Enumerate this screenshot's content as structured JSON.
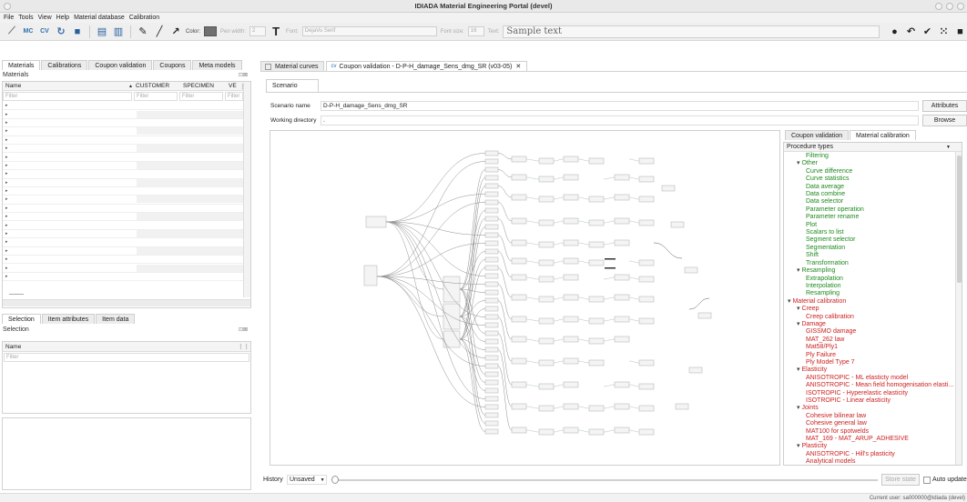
{
  "window": {
    "title": "IDIADA Material Engineering Portal (devel)"
  },
  "menu": [
    "File",
    "Tools",
    "View",
    "Help",
    "Material database",
    "Calibration"
  ],
  "toolbar": {
    "color_label": "Color:",
    "pen_width_label": "Pen width:",
    "pen_width_value": "2",
    "font_label": "Font:",
    "font_value": "DejaVu Serif",
    "font_size_label": "Font size:",
    "font_size_value": "16",
    "text_label": "Text:",
    "sample_text": "Sample text",
    "color_swatch": "#707070"
  },
  "left_tabs": [
    "Materials",
    "Calibrations",
    "Coupon validation",
    "Coupons",
    "Meta models"
  ],
  "materials": {
    "title": "Materials",
    "columns": [
      "Name",
      "CUSTOMER",
      "SPECIMEN",
      "VE"
    ],
    "filter_placeholder": "Filter",
    "last_row": "--------"
  },
  "selection_tabs": [
    "Selection",
    "Item attributes",
    "Item data"
  ],
  "selection": {
    "title": "Selection",
    "column": "Name",
    "filter_placeholder": "Filter"
  },
  "doc_tabs": [
    {
      "label": "Material curves",
      "active": false
    },
    {
      "label": "Coupon validation - D-P-H_damage_Sens_dmg_SR (v03-05)",
      "active": true
    }
  ],
  "scenario": {
    "tab": "Scenario",
    "name_label": "Scenario name",
    "name_value": "D-P-H_damage_Sens_dmg_SR",
    "workdir_label": "Working directory",
    "workdir_value": ".",
    "attributes_btn": "Attributes",
    "browse_btn": "Browse"
  },
  "right_tabs": [
    "Coupon validation",
    "Material calibration"
  ],
  "procedure": {
    "title": "Procedure types",
    "items": [
      {
        "text": "Filtering",
        "level": 2,
        "cls": "g"
      },
      {
        "text": "Other",
        "level": 1,
        "cls": "g",
        "group": true
      },
      {
        "text": "Curve difference",
        "level": 2,
        "cls": "g"
      },
      {
        "text": "Curve statistics",
        "level": 2,
        "cls": "g"
      },
      {
        "text": "Data average",
        "level": 2,
        "cls": "g"
      },
      {
        "text": "Data combine",
        "level": 2,
        "cls": "g"
      },
      {
        "text": "Data selector",
        "level": 2,
        "cls": "g"
      },
      {
        "text": "Parameter operation",
        "level": 2,
        "cls": "g"
      },
      {
        "text": "Parameter rename",
        "level": 2,
        "cls": "g"
      },
      {
        "text": "Plot",
        "level": 2,
        "cls": "g"
      },
      {
        "text": "Scalars to list",
        "level": 2,
        "cls": "g"
      },
      {
        "text": "Segment selector",
        "level": 2,
        "cls": "g"
      },
      {
        "text": "Segmentation",
        "level": 2,
        "cls": "g"
      },
      {
        "text": "Shift",
        "level": 2,
        "cls": "g"
      },
      {
        "text": "Transformation",
        "level": 2,
        "cls": "g"
      },
      {
        "text": "Resampling",
        "level": 1,
        "cls": "g",
        "group": true
      },
      {
        "text": "Extrapolation",
        "level": 2,
        "cls": "g"
      },
      {
        "text": "Interpolation",
        "level": 2,
        "cls": "g"
      },
      {
        "text": "Resampling",
        "level": 2,
        "cls": "g"
      },
      {
        "text": "Material calibration",
        "level": 0,
        "cls": "r",
        "group": true
      },
      {
        "text": "Creep",
        "level": 1,
        "cls": "r",
        "group": true
      },
      {
        "text": "Creep calibration",
        "level": 2,
        "cls": "r"
      },
      {
        "text": "Damage",
        "level": 1,
        "cls": "r",
        "group": true
      },
      {
        "text": "GISSMO damage",
        "level": 2,
        "cls": "r"
      },
      {
        "text": "MAT_262 law",
        "level": 2,
        "cls": "r"
      },
      {
        "text": "Mat58/Ply1",
        "level": 2,
        "cls": "r"
      },
      {
        "text": "Ply Failure",
        "level": 2,
        "cls": "r"
      },
      {
        "text": "Ply Model Type 7",
        "level": 2,
        "cls": "r"
      },
      {
        "text": "Elasticity",
        "level": 1,
        "cls": "r",
        "group": true
      },
      {
        "text": "ANISOTROPIC - ML elasticty model",
        "level": 2,
        "cls": "r"
      },
      {
        "text": "ANISOTROPIC - Mean field homogenisation elasti...",
        "level": 2,
        "cls": "r"
      },
      {
        "text": "ISOTROPIC - Hyperelastic elasticity",
        "level": 2,
        "cls": "r"
      },
      {
        "text": "ISOTROPIC - Linear elasticity",
        "level": 2,
        "cls": "r"
      },
      {
        "text": "Joints",
        "level": 1,
        "cls": "r",
        "group": true
      },
      {
        "text": "Cohesive bilinear law",
        "level": 2,
        "cls": "r"
      },
      {
        "text": "Cohesive general law",
        "level": 2,
        "cls": "r"
      },
      {
        "text": "MAT100 for spotwelds",
        "level": 2,
        "cls": "r"
      },
      {
        "text": "MAT_169 - MAT_ARUP_ADHESIVE",
        "level": 2,
        "cls": "r"
      },
      {
        "text": "Plasticity",
        "level": 1,
        "cls": "r",
        "group": true
      },
      {
        "text": "ANISOTROPIC - Hill's plasticity",
        "level": 2,
        "cls": "r"
      },
      {
        "text": "Analytical models",
        "level": 2,
        "cls": "r"
      }
    ]
  },
  "history": {
    "label": "History",
    "value": "Unsaved",
    "store_btn": "Store state",
    "auto_update": "Auto update"
  },
  "status": {
    "text": "Current user: sa000000@idiada (devel)"
  }
}
